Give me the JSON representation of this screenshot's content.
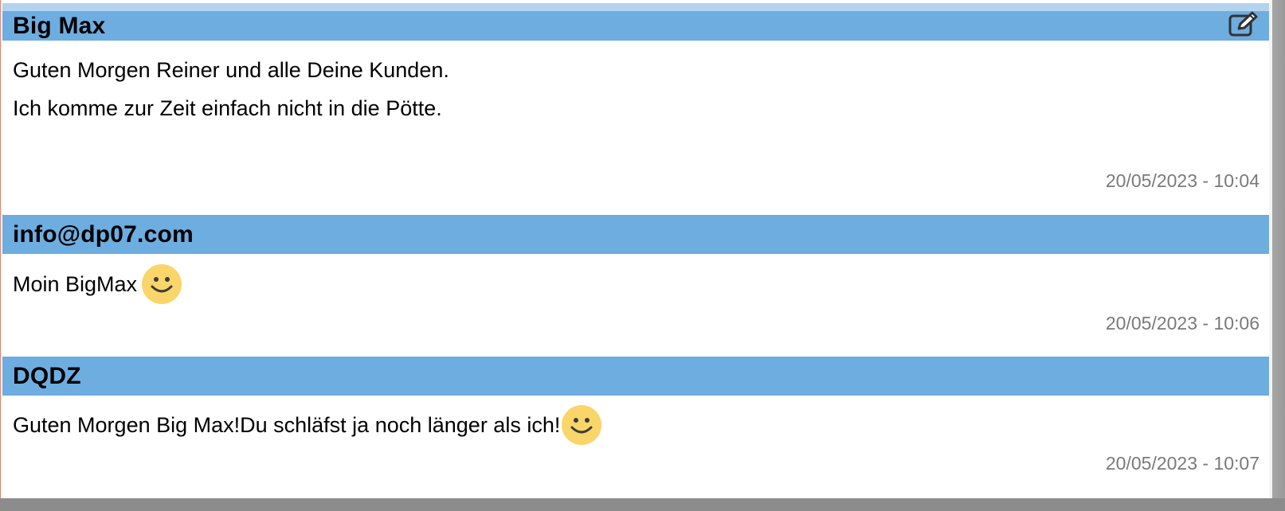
{
  "posts": [
    {
      "author": "Big Max",
      "lines": [
        "Guten Morgen Reiner und alle Deine Kunden.",
        "Ich komme zur Zeit einfach nicht in die Pötte."
      ],
      "timestamp": "20/05/2023 - 10:04",
      "has_edit": true,
      "edit_icon": "edit-icon"
    },
    {
      "author": "info@dp07.com",
      "lines": [
        "Moin BigMax"
      ],
      "timestamp": "20/05/2023 - 10:06",
      "emoji": "smiley-icon"
    },
    {
      "author": "DQDZ",
      "lines": [
        "Guten Morgen Big Max!Du schläfst ja noch länger als ich!"
      ],
      "timestamp": "20/05/2023 - 10:07",
      "emoji": "smiley-icon"
    }
  ],
  "colors": {
    "header_bg": "#6eade0",
    "timestamp": "#7a7a7a",
    "smiley": "#f9d56a"
  }
}
